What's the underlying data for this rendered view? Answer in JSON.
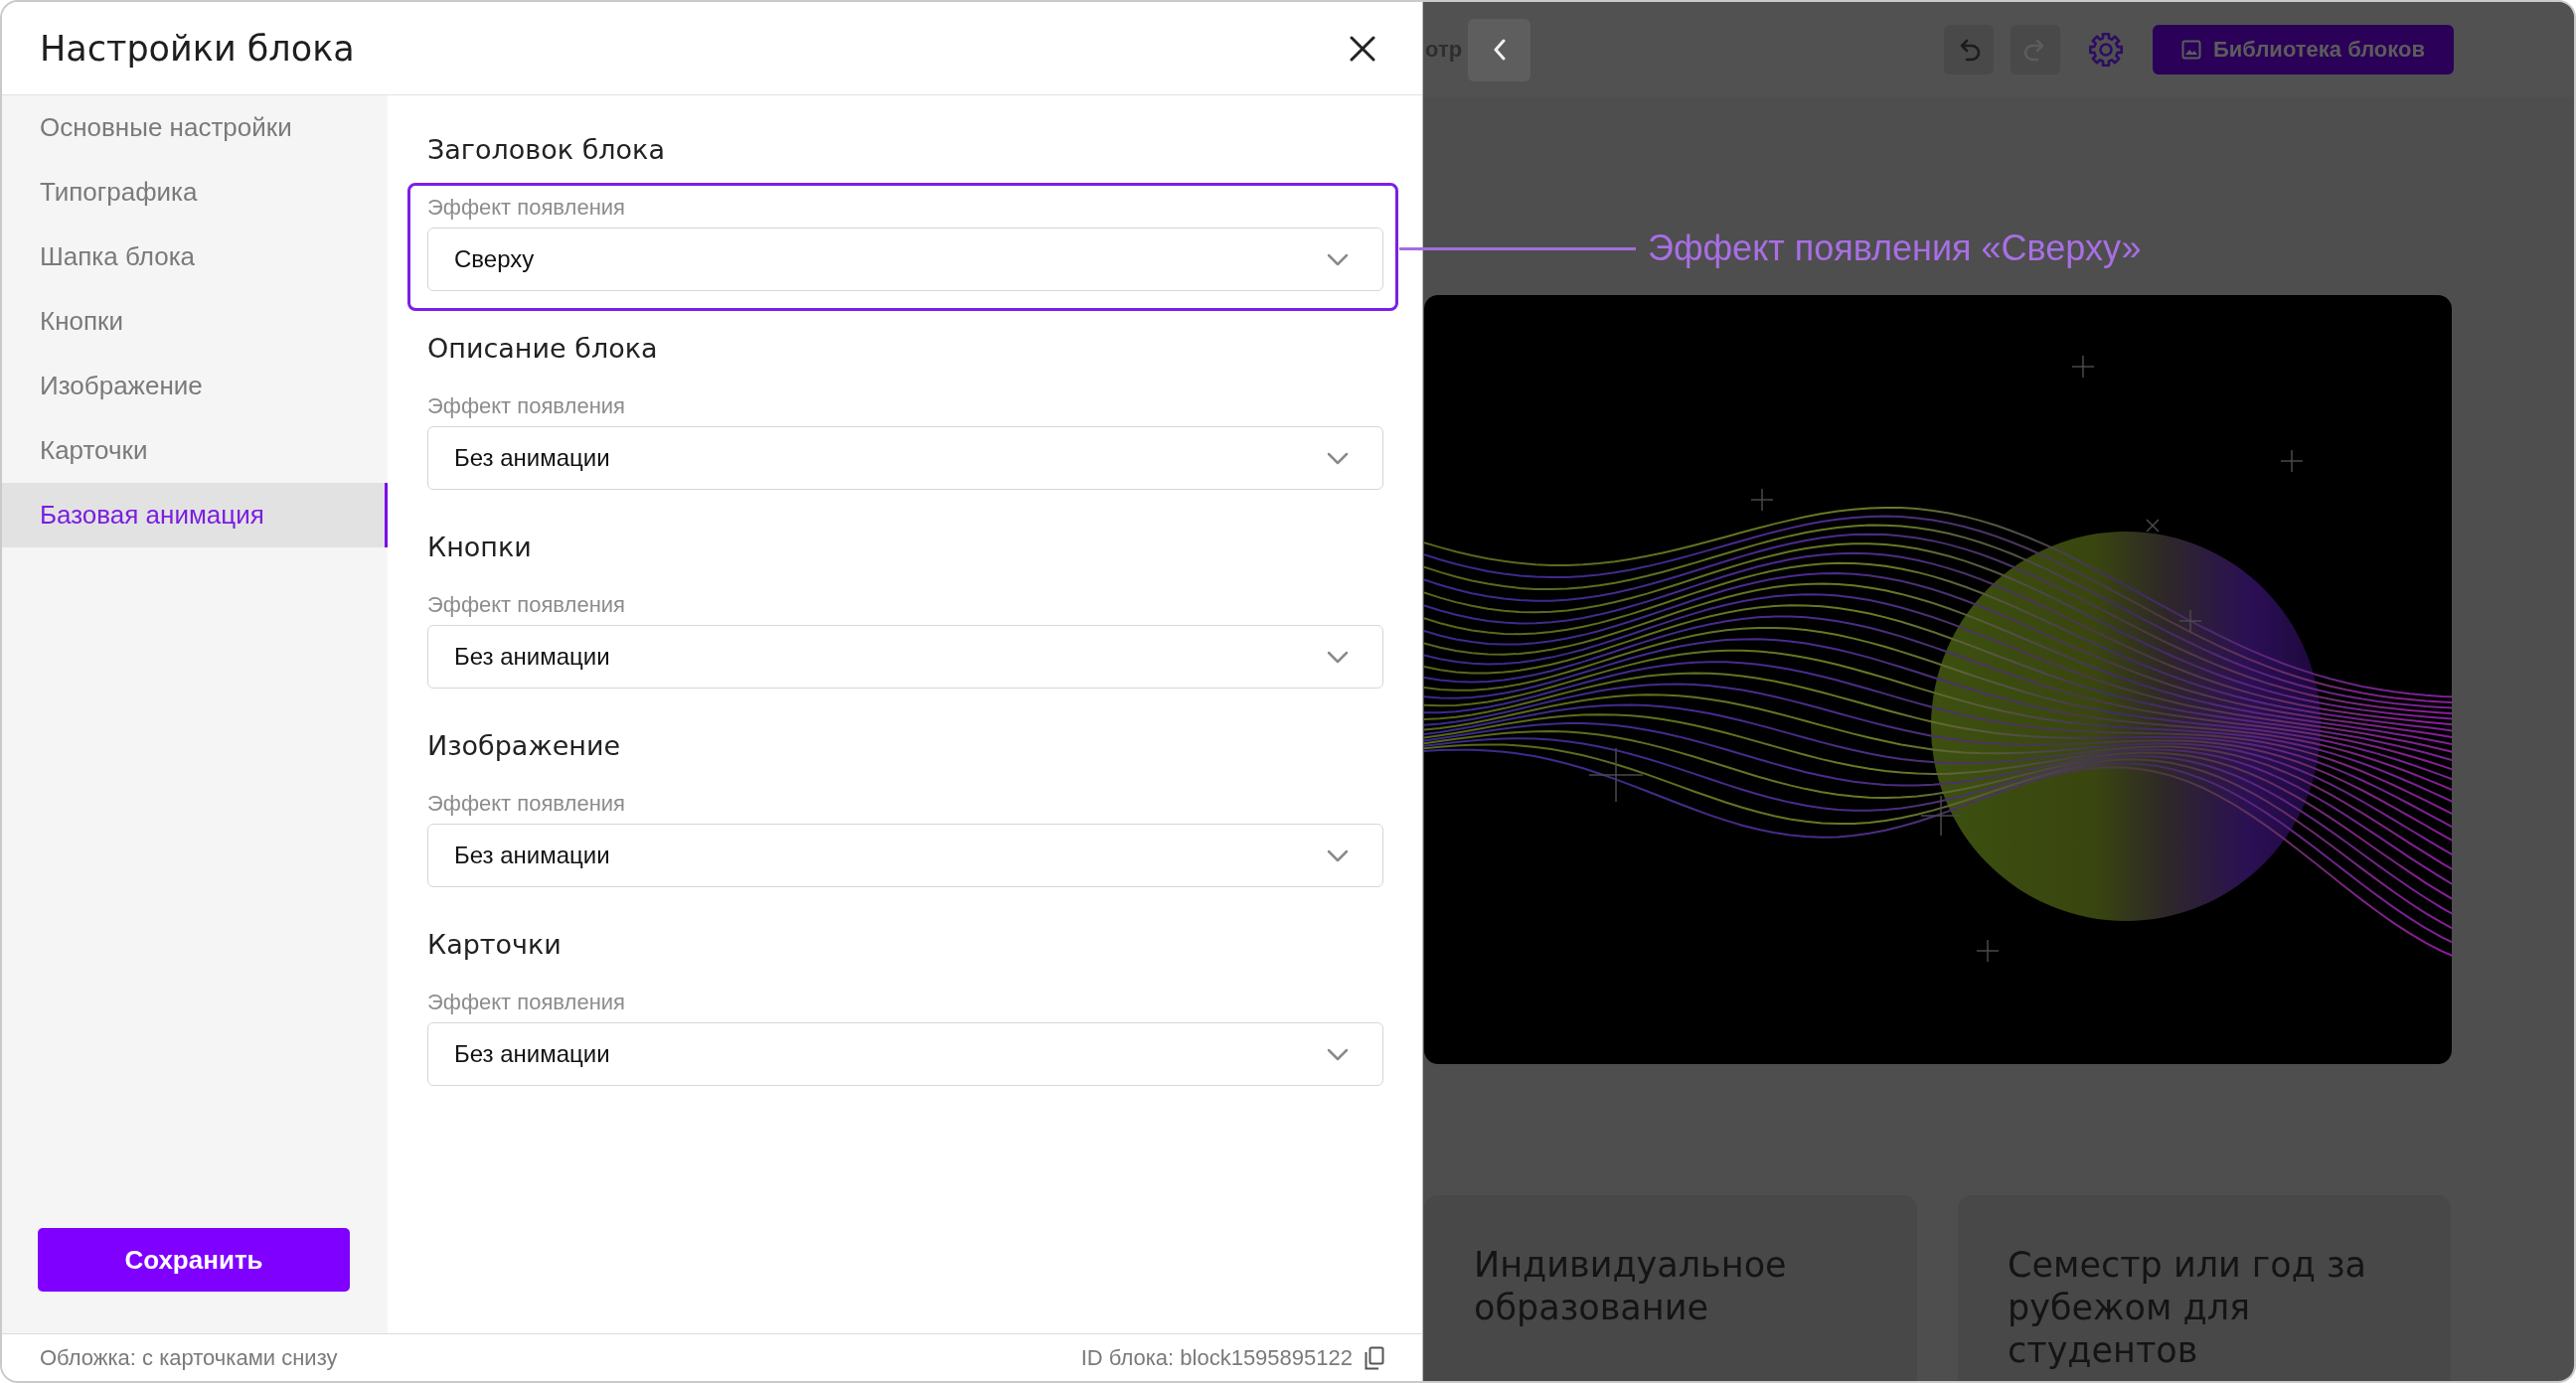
{
  "panel": {
    "title": "Настройки блока"
  },
  "sidebar": {
    "items": [
      {
        "label": "Основные настройки",
        "selected": false
      },
      {
        "label": "Типографика",
        "selected": false
      },
      {
        "label": "Шапка блока",
        "selected": false
      },
      {
        "label": "Кнопки",
        "selected": false
      },
      {
        "label": "Изображение",
        "selected": false
      },
      {
        "label": "Карточки",
        "selected": false
      },
      {
        "label": "Базовая анимация",
        "selected": true
      }
    ],
    "save_button": "Сохранить"
  },
  "sections": [
    {
      "heading": "Заголовок блока",
      "field_label": "Эффект появления",
      "value": "Сверху",
      "highlighted": true
    },
    {
      "heading": "Описание блока",
      "field_label": "Эффект появления",
      "value": "Без анимации",
      "highlighted": false
    },
    {
      "heading": "Кнопки",
      "field_label": "Эффект появления",
      "value": "Без анимации",
      "highlighted": false
    },
    {
      "heading": "Изображение",
      "field_label": "Эффект появления",
      "value": "Без анимации",
      "highlighted": false
    },
    {
      "heading": "Карточки",
      "field_label": "Эффект появления",
      "value": "Без анимации",
      "highlighted": false
    }
  ],
  "footer": {
    "block_type": "Обложка: с карточками снизу",
    "block_id": "ID блока: block1595895122"
  },
  "preview": {
    "toolbar": {
      "cut_off_label": "отр",
      "buttons": [
        {
          "kind": "undo",
          "disabled": false
        },
        {
          "kind": "redo",
          "disabled": true
        }
      ],
      "library_button": "Библиотека блоков"
    },
    "cards": [
      {
        "title": "Индивидуальное образование"
      },
      {
        "title": "Семестр или год за рубежом для студентов"
      }
    ]
  },
  "annotation": {
    "text": "Эффект появления «Сверху»"
  }
}
